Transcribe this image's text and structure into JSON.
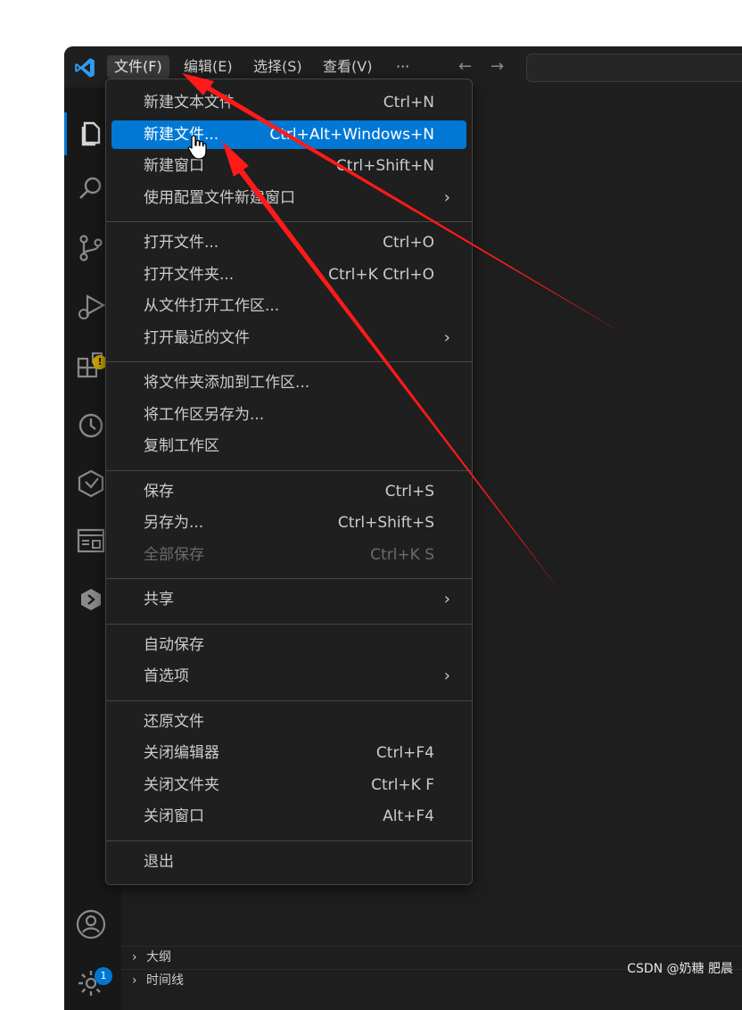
{
  "titlebar": {
    "menus": [
      {
        "label": "文件(F)",
        "active": true
      },
      {
        "label": "编辑(E)",
        "active": false
      },
      {
        "label": "选择(S)",
        "active": false
      },
      {
        "label": "查看(V)",
        "active": false
      },
      {
        "label": "···",
        "active": false
      }
    ],
    "back_icon": "arrow-left-icon",
    "forward_icon": "arrow-right-icon"
  },
  "file_menu": {
    "groups": [
      [
        {
          "label": "新建文本文件",
          "shortcut": "Ctrl+N"
        },
        {
          "label": "新建文件...",
          "shortcut": "Ctrl+Alt+Windows+N",
          "highlighted": true
        },
        {
          "label": "新建窗口",
          "shortcut": "Ctrl+Shift+N"
        },
        {
          "label": "使用配置文件新建窗口",
          "submenu": true
        }
      ],
      [
        {
          "label": "打开文件...",
          "shortcut": "Ctrl+O"
        },
        {
          "label": "打开文件夹...",
          "shortcut": "Ctrl+K Ctrl+O"
        },
        {
          "label": "从文件打开工作区..."
        },
        {
          "label": "打开最近的文件",
          "submenu": true
        }
      ],
      [
        {
          "label": "将文件夹添加到工作区..."
        },
        {
          "label": "将工作区另存为..."
        },
        {
          "label": "复制工作区"
        }
      ],
      [
        {
          "label": "保存",
          "shortcut": "Ctrl+S"
        },
        {
          "label": "另存为...",
          "shortcut": "Ctrl+Shift+S"
        },
        {
          "label": "全部保存",
          "shortcut": "Ctrl+K S",
          "disabled": true
        }
      ],
      [
        {
          "label": "共享",
          "submenu": true
        }
      ],
      [
        {
          "label": "自动保存"
        },
        {
          "label": "首选项",
          "submenu": true
        }
      ],
      [
        {
          "label": "还原文件"
        },
        {
          "label": "关闭编辑器",
          "shortcut": "Ctrl+F4"
        },
        {
          "label": "关闭文件夹",
          "shortcut": "Ctrl+K F"
        },
        {
          "label": "关闭窗口",
          "shortcut": "Alt+F4"
        }
      ],
      [
        {
          "label": "退出"
        }
      ]
    ]
  },
  "activitybar": {
    "icons": [
      "explorer-icon",
      "search-icon",
      "source-control-icon",
      "run-debug-icon",
      "extensions-icon",
      "timeline-icon",
      "extension-plugin-icon",
      "remote-explorer-icon",
      "cube-extension-icon",
      "account-icon",
      "settings-gear-icon"
    ],
    "extensions_badge": "!",
    "settings_badge": "1"
  },
  "sidebar_panels": {
    "outline_label": "大纲",
    "timeline_label": "时间线"
  },
  "colors": {
    "accent": "#0078d4",
    "annotation_arrow": "#ff1a1a",
    "menu_bg": "#1f1f1f"
  },
  "watermark": "CSDN @奶糖 肥晨"
}
